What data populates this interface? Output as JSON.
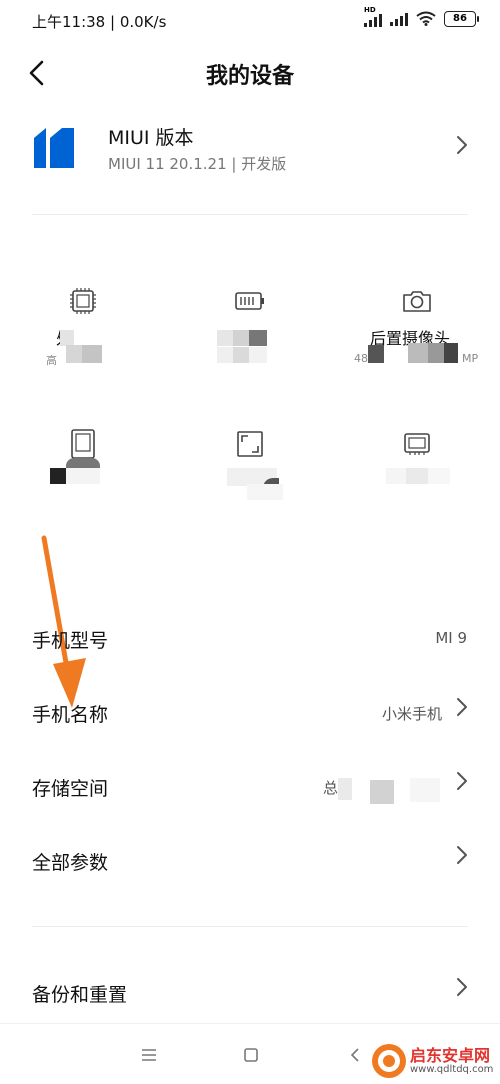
{
  "status_bar": {
    "time_speed": "上午11:38 | 0.0K/s",
    "signal_badge": "HD",
    "battery": "86"
  },
  "header": {
    "back_icon": "back-arrow-icon",
    "title": "我的设备"
  },
  "miui": {
    "title": "MIUI 版本",
    "subtitle": "MIUI 11 20.1.21 | 开发版"
  },
  "specs": [
    {
      "icon": "processor-chip-icon",
      "label": "处",
      "value": "高"
    },
    {
      "icon": "battery-capacity-icon",
      "label": "",
      "value": ""
    },
    {
      "icon": "camera-icon",
      "label": "后置摄像头",
      "value": "48"
    },
    {
      "icon": "screen-icon",
      "label": "",
      "value": ""
    },
    {
      "icon": "resolution-icon",
      "label": "",
      "value": ""
    },
    {
      "icon": "memory-icon",
      "label": "",
      "value": ""
    }
  ],
  "rows": [
    {
      "label": "手机型号",
      "value": "MI 9",
      "chevron": false
    },
    {
      "label": "手机名称",
      "value": "小米手机",
      "chevron": true
    },
    {
      "label": "存储空间",
      "value": "总",
      "chevron": true
    },
    {
      "label": "全部参数",
      "value": "",
      "chevron": true
    },
    {
      "label": "备份和重置",
      "value": "",
      "chevron": true
    }
  ],
  "camera_mp_suffix": "MP",
  "arrow_color": "#f07a22",
  "accent_color": "#0063d3",
  "watermark": {
    "title": "启东安卓网",
    "url": "www.qdltdq.com"
  }
}
